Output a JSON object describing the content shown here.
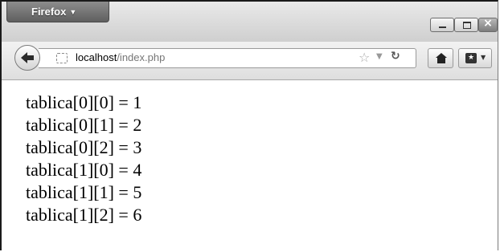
{
  "browser": {
    "menu_button_label": "Firefox",
    "url_host": "localhost",
    "url_path": "/index.php"
  },
  "page": {
    "lines": [
      "tablica[0][0] = 1",
      "tablica[0][1] = 2",
      "tablica[0][2] = 3",
      "tablica[1][0] = 4",
      "tablica[1][1] = 5",
      "tablica[1][2] = 6"
    ]
  },
  "icons": {
    "back": "back-arrow-icon",
    "identity": "site-identity-icon",
    "bookmark_star": "star-icon",
    "history_dropdown": "chevron-down-icon",
    "reload": "reload-icon",
    "home": "home-icon",
    "bookmarks": "bookmarks-icon"
  }
}
